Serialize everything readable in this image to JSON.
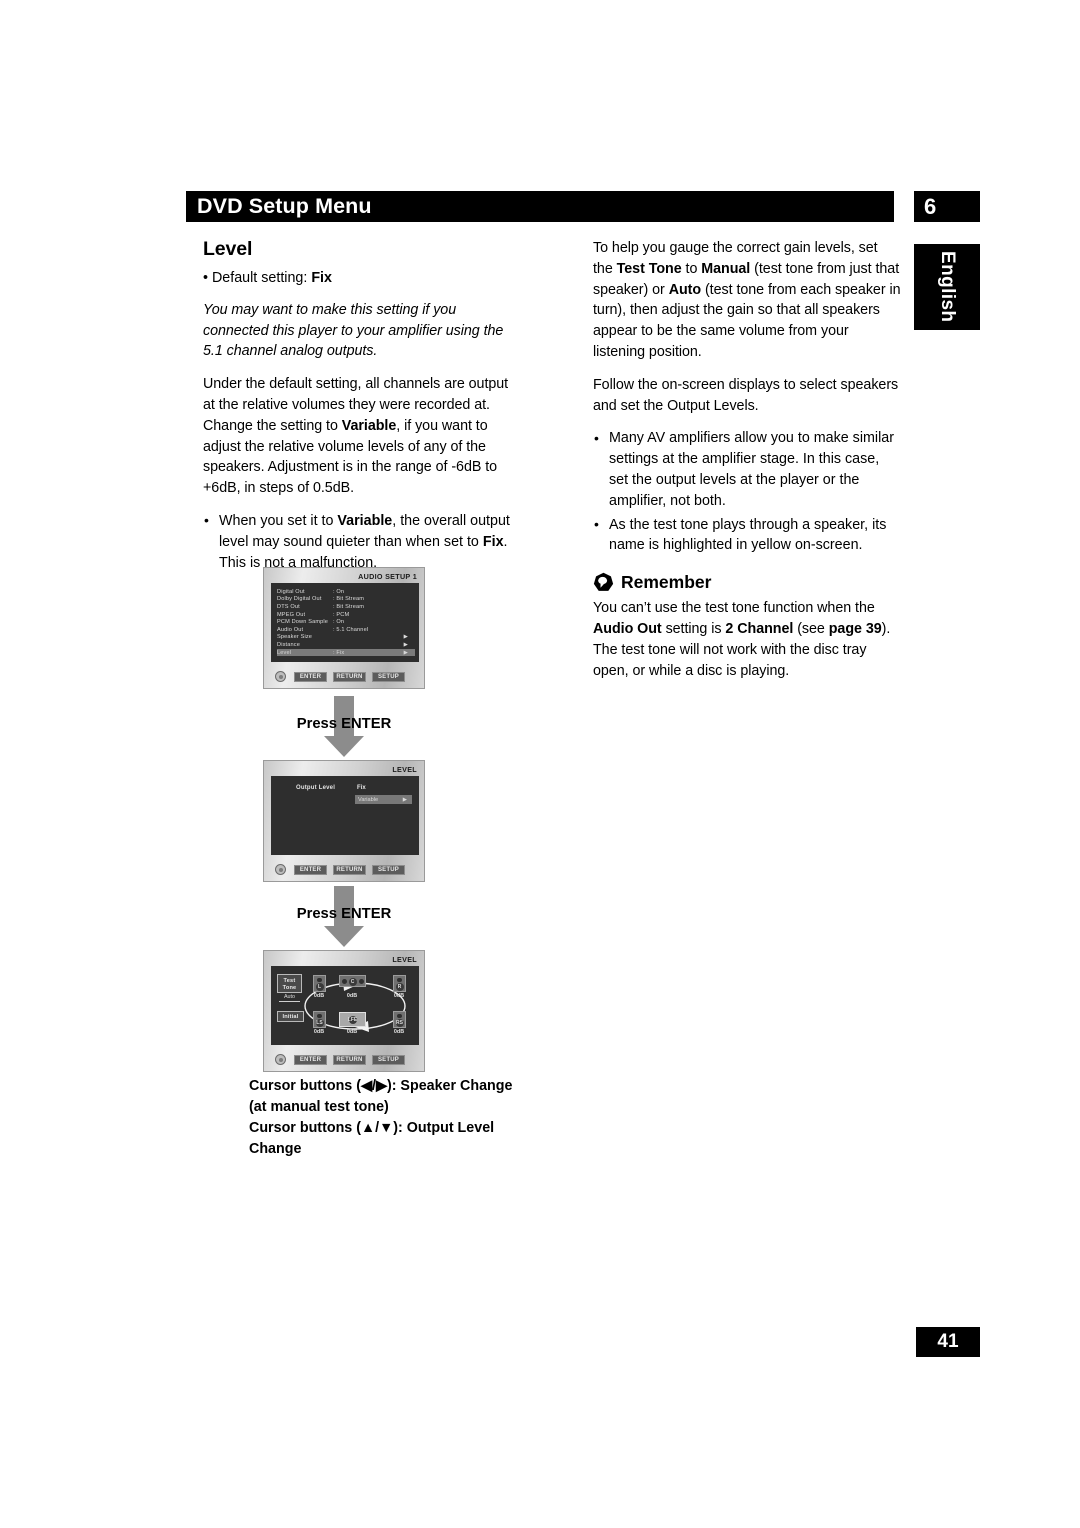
{
  "header": {
    "title": "DVD Setup Menu",
    "chapter": "6",
    "language_tab": "English",
    "page_number": "41"
  },
  "left_column": {
    "section_title": "Level",
    "default_setting_prefix": "• Default setting: ",
    "default_setting_value": "Fix",
    "italic_note": "You may want to make this setting if you connected this player to your amplifier using the 5.1 channel analog outputs.",
    "paragraph_1_a": "Under the default setting, all channels are output at the relative volumes they were recorded at. Change the setting to ",
    "paragraph_1_bold": "Variable",
    "paragraph_1_b": ", if you want to adjust the relative volume levels of any of the speakers. Adjustment is in the range of -6dB to +6dB, in steps of 0.5dB.",
    "bullet_1_a": "When you set it to ",
    "bullet_1_bold1": "Variable",
    "bullet_1_b": ", the overall output level may sound quieter than when set to ",
    "bullet_1_bold2": "Fix",
    "bullet_1_c": ". This is not a malfunction."
  },
  "right_column": {
    "paragraph_1_a": "To help you gauge the correct gain levels, set the ",
    "paragraph_1_bold1": "Test Tone",
    "paragraph_1_b": " to ",
    "paragraph_1_bold2": "Manual",
    "paragraph_1_c": " (test tone from just that speaker) or ",
    "paragraph_1_bold3": "Auto",
    "paragraph_1_d": " (test tone from each speaker in turn), then adjust the gain so that all speakers appear to be the same volume from your listening position.",
    "paragraph_2": "Follow the on-screen displays to select speakers and set the Output Levels.",
    "bullet_1": "Many AV amplifiers allow you to make similar settings at the amplifier stage. In this case, set the output levels at the player or the amplifier, not both.",
    "bullet_2": "As the test tone plays through a speaker, its name is highlighted in yellow on-screen.",
    "remember_label": "Remember",
    "remember_a": "You can’t use the test tone function when the ",
    "remember_bold1": "Audio Out",
    "remember_b": " setting is ",
    "remember_bold2": "2 Channel",
    "remember_c": " (see ",
    "remember_bold3": "page 39",
    "remember_d": "). The test tone will not work with the disc tray open, or while a disc is playing."
  },
  "screens": {
    "audio_setup": {
      "title": "AUDIO SETUP 1",
      "rows": [
        {
          "key": "Digital Out",
          "value": ": On",
          "arrow": ""
        },
        {
          "key": "Dolby Digital Out",
          "value": ": Bit Stream",
          "arrow": ""
        },
        {
          "key": "DTS Out",
          "value": ": Bit Stream",
          "arrow": ""
        },
        {
          "key": "MPEG Out",
          "value": ": PCM",
          "arrow": ""
        },
        {
          "key": "PCM Down Sample",
          "value": ": On",
          "arrow": ""
        },
        {
          "key": "Audio Out",
          "value": ": 5.1  Channel",
          "arrow": ""
        },
        {
          "key": "Speaker Size",
          "value": "",
          "arrow": "▶"
        },
        {
          "key": "Distance",
          "value": "",
          "arrow": "▶"
        },
        {
          "key": "Level",
          "value": ": Fix",
          "arrow": "▶"
        }
      ],
      "buttons": [
        "ENTER",
        "RETURN",
        "SETUP"
      ]
    },
    "level_select": {
      "title": "LEVEL",
      "label": "Output Level",
      "option_fix": "Fix",
      "option_variable": "Variable",
      "option_variable_arrow": "▶",
      "buttons": [
        "ENTER",
        "RETURN",
        "SETUP"
      ]
    },
    "level_speakers": {
      "title": "LEVEL",
      "test_tone_label": "Test\nTone",
      "test_tone_line1": "Test",
      "test_tone_line2": "Tone",
      "auto_label": "Auto",
      "initial_label": "Initial",
      "speakers": [
        {
          "name": "L",
          "level": "0dB",
          "selected": false
        },
        {
          "name": "C",
          "level": "0dB",
          "selected": false
        },
        {
          "name": "R",
          "level": "0dB",
          "selected": false
        },
        {
          "name": "LS",
          "level": "0dB",
          "selected": false
        },
        {
          "name": "LFE",
          "level": "0dB",
          "selected": true
        },
        {
          "name": "RS",
          "level": "0dB",
          "selected": false
        }
      ],
      "buttons": [
        "ENTER",
        "RETURN",
        "SETUP"
      ]
    },
    "step_label_1": "Press ENTER",
    "step_label_2": "Press ENTER"
  },
  "caption": {
    "line1": "Cursor buttons (◀/▶): Speaker Change",
    "line2": "(at manual test tone)",
    "line3": "Cursor buttons (▲/▼): Output Level",
    "line4": "Change"
  },
  "colors": {
    "header_bg": "#000000",
    "header_text": "#ffffff",
    "screen_bg": "#2e2e2e",
    "selected_row": "#7b7b7b",
    "arrow_gray": "#8c8c8c"
  }
}
